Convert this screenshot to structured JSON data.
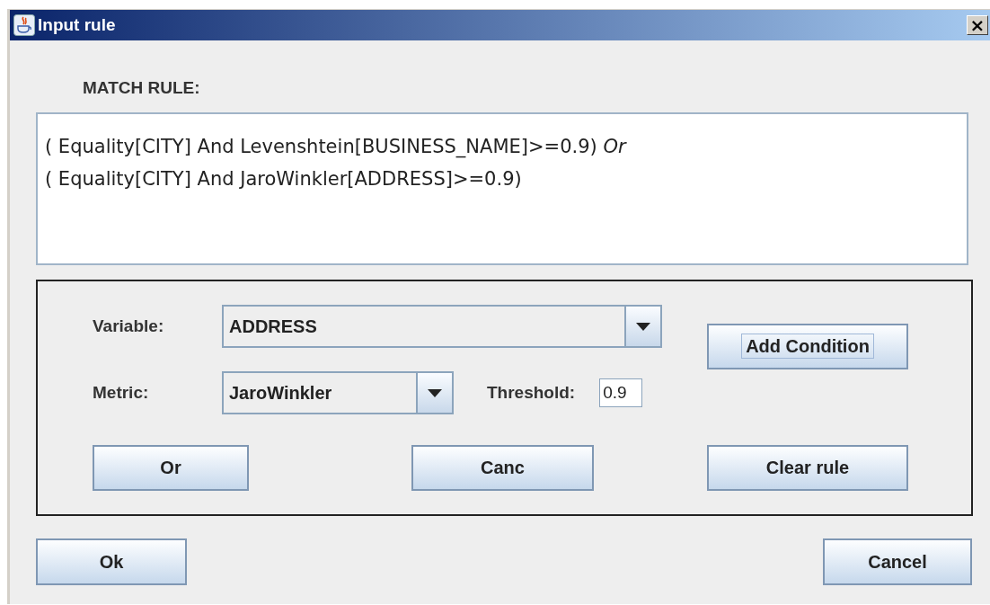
{
  "window": {
    "title": "Input rule",
    "close": "×"
  },
  "match_rule": {
    "label": "MATCH RULE:",
    "lines": [
      "( Equality[CITY] And Levenshtein[BUSINESS_NAME]>=0.9) *Or*",
      "( Equality[CITY] And JaroWinkler[ADDRESS]>=0.9)"
    ]
  },
  "variable": {
    "label": "Variable:",
    "value": "ADDRESS"
  },
  "metric": {
    "label": "Metric:",
    "value": "JaroWinkler"
  },
  "threshold": {
    "label": "Threshold:",
    "value": "0.9"
  },
  "add_condition": {
    "label": "Add Condition",
    "focused": true
  },
  "panel_buttons": [
    {
      "label": "Or"
    },
    {
      "label": "Canc"
    },
    {
      "label": "Clear rule"
    }
  ],
  "footer_buttons": [
    {
      "label": "Ok"
    },
    {
      "label": "Cancel"
    }
  ]
}
